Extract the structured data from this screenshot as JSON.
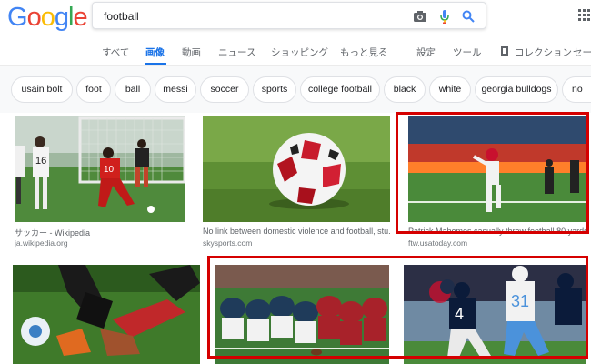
{
  "logo": {
    "letters": [
      "G",
      "o",
      "o",
      "g",
      "l",
      "e"
    ]
  },
  "search": {
    "query": "football"
  },
  "icons": {
    "camera": "camera-icon",
    "mic": "microphone-icon",
    "search": "search-icon",
    "apps": "apps-grid-icon",
    "collection": "bookmark-icon"
  },
  "tabs": [
    {
      "label": "すべて"
    },
    {
      "label": "画像"
    },
    {
      "label": "動画"
    },
    {
      "label": "ニュース"
    },
    {
      "label": "ショッピング"
    },
    {
      "label": "もっと見る"
    },
    {
      "label": "設定"
    },
    {
      "label": "ツール"
    },
    {
      "label": "コレクション"
    },
    {
      "label": "セーフ"
    }
  ],
  "active_tab": "画像",
  "chips": [
    {
      "label": "usain bolt"
    },
    {
      "label": "foot"
    },
    {
      "label": "ball"
    },
    {
      "label": "messi"
    },
    {
      "label": "soccer"
    },
    {
      "label": "sports"
    },
    {
      "label": "college football"
    },
    {
      "label": "black"
    },
    {
      "label": "white"
    },
    {
      "label": "georgia bulldogs"
    },
    {
      "label": "no"
    }
  ],
  "results": [
    {
      "title": "サッカー - Wikipedia",
      "source": "ja.wikipedia.org"
    },
    {
      "title": "No link between domestic violence and football, stu...",
      "source": "skysports.com"
    },
    {
      "title": "Patrick Mahomes casually threw football 80 yards ...",
      "source": "ftw.usatoday.com"
    },
    {
      "title": "",
      "source": ""
    },
    {
      "title": "",
      "source": ""
    },
    {
      "title": "",
      "source": ""
    }
  ],
  "jersey_numbers": {
    "player1": "16",
    "player2": "10",
    "player3": "4",
    "player4": "31"
  },
  "colors": {
    "highlight": "#d50000",
    "accent": "#1a73e8"
  }
}
